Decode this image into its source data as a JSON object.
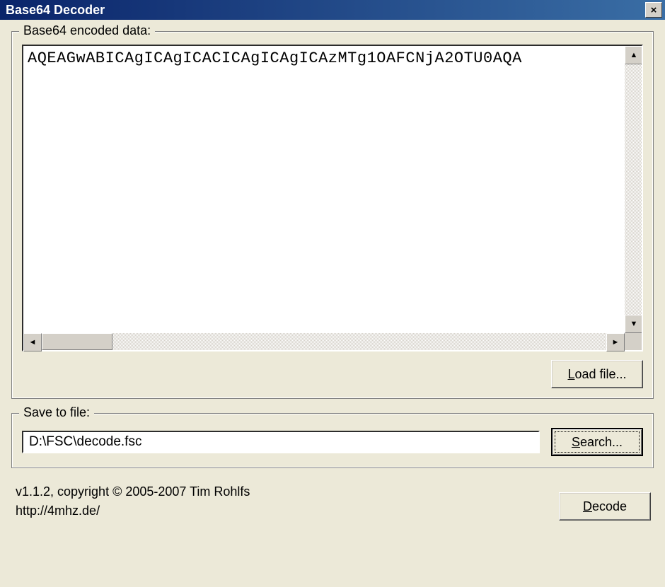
{
  "window": {
    "title": "Base64 Decoder",
    "close_label": "×"
  },
  "encoded": {
    "group_label": "Base64 encoded data:",
    "content": "AQEAGwABICAgICAgICACICAgICAgICAzMTg1OAFCNjA2OTU0AQA",
    "load_button": "Load file...",
    "load_underline": "L"
  },
  "save": {
    "group_label": "Save to file:",
    "path": "D:\\FSC\\decode.fsc",
    "search_button": "Search...",
    "search_underline": "S"
  },
  "footer": {
    "version_line": "v1.1.2, copyright © 2005-2007 Tim Rohlfs",
    "url_line": "http://4mhz.de/",
    "decode_button": "Decode",
    "decode_underline": "D"
  },
  "scroll": {
    "up": "▲",
    "down": "▼",
    "left": "◄",
    "right": "►"
  }
}
